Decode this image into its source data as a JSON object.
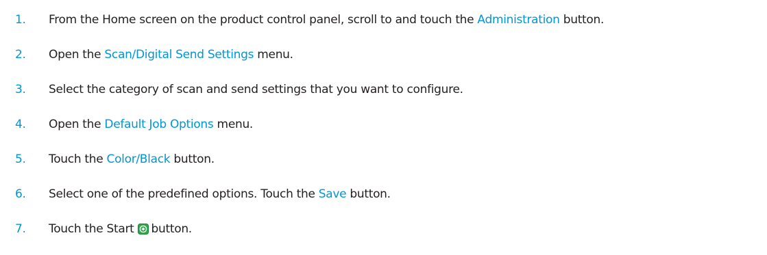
{
  "steps": [
    {
      "number": "1.",
      "before": "From the Home screen on the product control panel, scroll to and touch the ",
      "link": "Administration",
      "after": " button."
    },
    {
      "number": "2.",
      "before": "Open the ",
      "link": "Scan/Digital Send Settings",
      "after": " menu."
    },
    {
      "number": "3.",
      "text": "Select the category of scan and send settings that you want to configure."
    },
    {
      "number": "4.",
      "before": "Open the ",
      "link": "Default Job Options",
      "after": " menu."
    },
    {
      "number": "5.",
      "before": "Touch the ",
      "link": "Color/Black",
      "after": " button."
    },
    {
      "number": "6.",
      "before": "Select one of the predefined options. Touch the ",
      "link": "Save",
      "after": " button."
    },
    {
      "number": "7.",
      "before": "Touch the Start",
      "icon": "start-button-icon",
      "after": "button."
    }
  ],
  "colors": {
    "accent": "#0096d6",
    "text": "#231f20",
    "start_icon_green": "#2eaa4a"
  }
}
